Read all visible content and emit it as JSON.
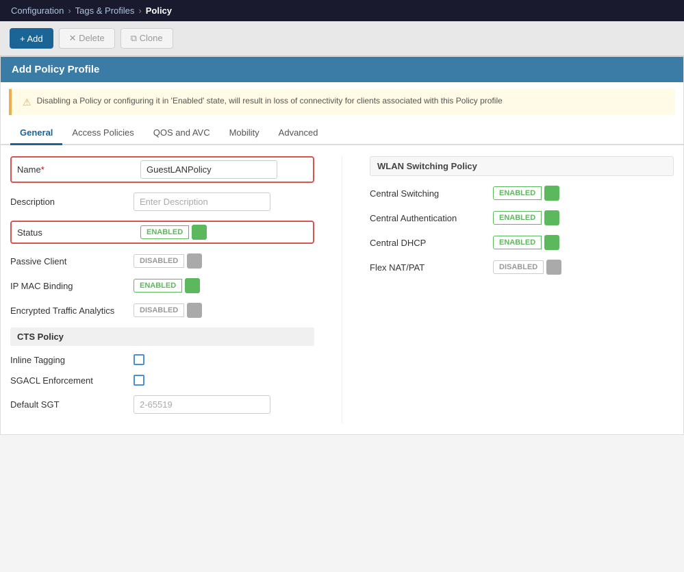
{
  "topnav": {
    "configuration": "Configuration",
    "tags_profiles": "Tags & Profiles",
    "policy": "Policy"
  },
  "toolbar": {
    "add_label": "+ Add",
    "delete_label": "✕ Delete",
    "clone_label": "⧉ Clone"
  },
  "form_header": "Add Policy Profile",
  "warning": {
    "icon": "⚠",
    "text": "Disabling a Policy or configuring it in 'Enabled' state, will result in loss of connectivity for clients associated with this Policy profile"
  },
  "tabs": [
    {
      "id": "general",
      "label": "General",
      "active": true
    },
    {
      "id": "access_policies",
      "label": "Access Policies",
      "active": false
    },
    {
      "id": "qos_avc",
      "label": "QOS and AVC",
      "active": false
    },
    {
      "id": "mobility",
      "label": "Mobility",
      "active": false
    },
    {
      "id": "advanced",
      "label": "Advanced",
      "active": false
    }
  ],
  "left_col": {
    "name_label": "Name",
    "name_required": "*",
    "name_value": "GuestLANPolicy",
    "desc_label": "Description",
    "desc_placeholder": "Enter Description",
    "status_label": "Status",
    "status_toggle": "ENABLED",
    "status_on": true,
    "passive_label": "Passive Client",
    "passive_toggle": "DISABLED",
    "passive_on": false,
    "ip_mac_label": "IP MAC Binding",
    "ip_mac_toggle": "ENABLED",
    "ip_mac_on": true,
    "eta_label": "Encrypted Traffic Analytics",
    "eta_toggle": "DISABLED",
    "eta_on": false,
    "cts_section": "CTS Policy",
    "inline_tagging_label": "Inline Tagging",
    "sgacl_label": "SGACL Enforcement",
    "default_sgt_label": "Default SGT",
    "default_sgt_placeholder": "2-65519"
  },
  "right_col": {
    "wlan_section_title": "WLAN Switching Policy",
    "central_switching_label": "Central Switching",
    "central_switching_toggle": "ENABLED",
    "central_switching_on": true,
    "central_auth_label": "Central Authentication",
    "central_auth_toggle": "ENABLED",
    "central_auth_on": true,
    "central_dhcp_label": "Central DHCP",
    "central_dhcp_toggle": "ENABLED",
    "central_dhcp_on": true,
    "flex_nat_label": "Flex NAT/PAT",
    "flex_nat_toggle": "DISABLED",
    "flex_nat_on": false
  }
}
